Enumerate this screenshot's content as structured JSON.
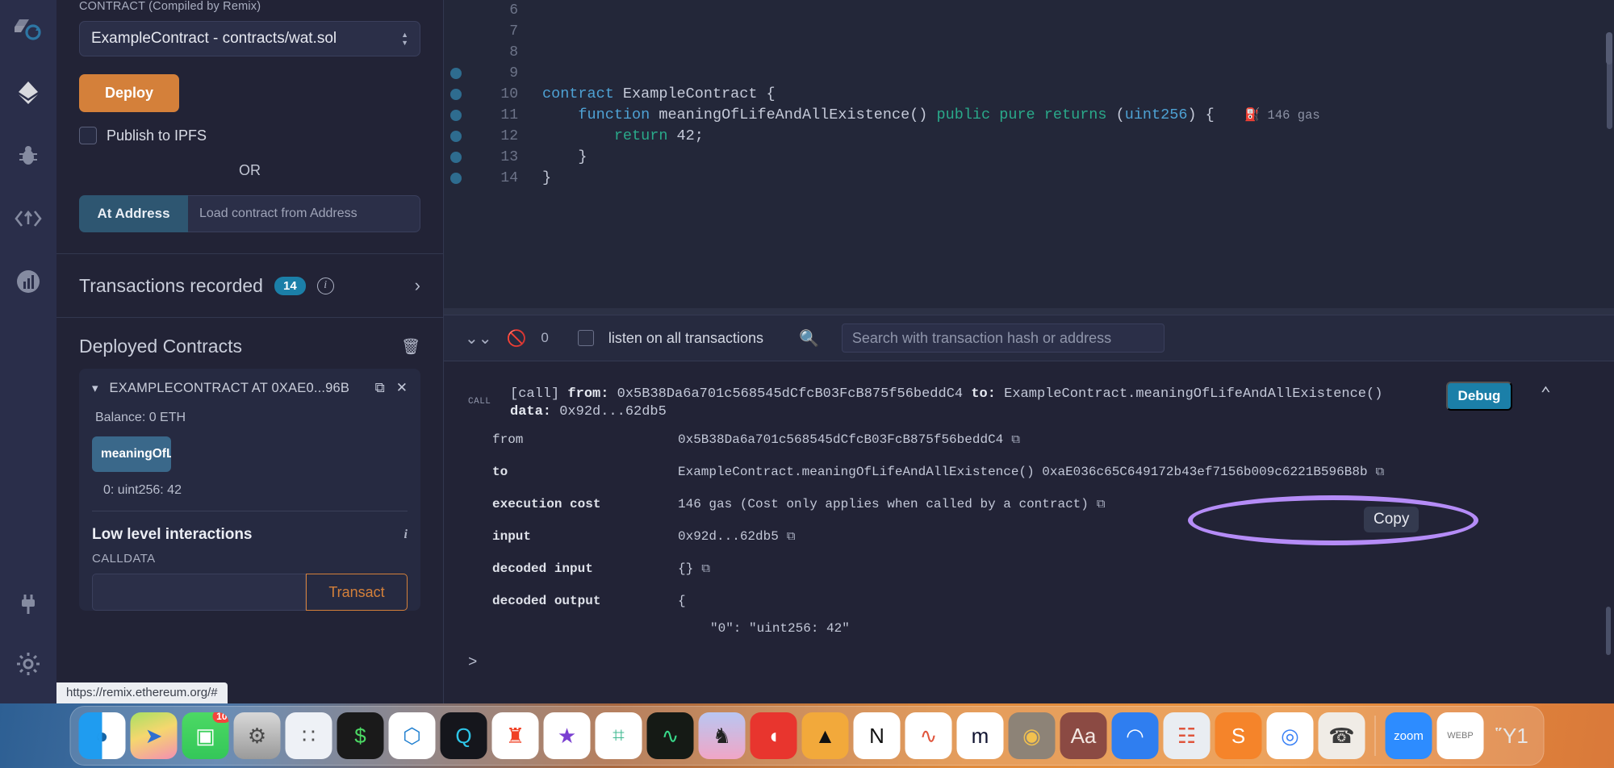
{
  "left_panel": {
    "contract_label": "CONTRACT (Compiled by Remix)",
    "contract_select": "ExampleContract - contracts/wat.sol",
    "deploy_button": "Deploy",
    "publish_ipfs": "Publish to IPFS",
    "or": "OR",
    "at_address_button": "At Address",
    "at_address_placeholder": "Load contract from Address",
    "transactions_recorded": "Transactions recorded",
    "transactions_count": "14",
    "deployed_contracts": "Deployed Contracts",
    "contract_instance": "EXAMPLECONTRACT AT 0XAE0...96B",
    "balance": "Balance: 0 ETH",
    "function_button": "meaningOfLifeAndAllExistence",
    "function_result": "0: uint256: 42",
    "low_level_title": "Low level interactions",
    "calldata_label": "CALLDATA",
    "calldata_value": "",
    "transact_button": "Transact"
  },
  "status_url": "https://remix.ethereum.org/#",
  "editor": {
    "lines": [
      {
        "num": "6",
        "marker": false,
        "code": ""
      },
      {
        "num": "7",
        "marker": false,
        "code": ""
      },
      {
        "num": "8",
        "marker": false,
        "code": ""
      },
      {
        "num": "9",
        "marker": true,
        "code": ""
      },
      {
        "num": "10",
        "marker": true,
        "code": "contract ExampleContract {"
      },
      {
        "num": "11",
        "marker": true,
        "code": "    function meaningOfLifeAndAllExistence() public pure returns (uint256) {"
      },
      {
        "num": "12",
        "marker": true,
        "code": "        return 42;"
      },
      {
        "num": "13",
        "marker": true,
        "code": "    }"
      },
      {
        "num": "14",
        "marker": true,
        "code": "}"
      }
    ],
    "gas_annotation": "146 gas"
  },
  "terminal": {
    "toolbar": {
      "pending_count": "0",
      "listen_label": "listen on all transactions",
      "search_placeholder": "Search with transaction hash or address"
    },
    "call_tag": "CALL",
    "call_line1_prefix": "[call]",
    "call_line1_from_label": "from:",
    "call_line1_from": "0x5B38Da6a701c568545dCfcB03FcB875f56beddC4",
    "call_line1_to_label": "to:",
    "call_line1_to": "ExampleContract.meaningOfLifeAndAllExistence()",
    "call_line2_label": "data:",
    "call_line2_data": "0x92d...62db5",
    "debug_button": "Debug",
    "rows": [
      {
        "key": "from",
        "value": "0x5B38Da6a701c568545dCfcB03FcB875f56beddC4",
        "copy": true
      },
      {
        "key": "to",
        "value": "ExampleContract.meaningOfLifeAndAllExistence() 0xaE036c65C649172b43ef7156b009c6221B596B8b",
        "copy": true
      },
      {
        "key": "execution cost",
        "value": "146 gas (Cost only applies when called by a contract)",
        "copy": true
      },
      {
        "key": "input",
        "value": "0x92d...62db5",
        "copy": true
      },
      {
        "key": "decoded input",
        "value": "{}",
        "copy": true
      },
      {
        "key": "decoded output",
        "value": "{",
        "copy": false
      }
    ],
    "decoded_output_body": "\"0\": \"uint256: 42\"",
    "copy_tooltip": "Copy",
    "prompt": ">"
  },
  "annotation": {
    "ellipse_color": "#b58cf7"
  },
  "dock": {
    "items": [
      {
        "name": "finder",
        "glyph": "◑",
        "bg": "linear-gradient(90deg,#1f9cf0 50%,#ffffff 50%)",
        "color": "#1565a6",
        "running": true
      },
      {
        "name": "maps",
        "glyph": "➤",
        "bg": "linear-gradient(160deg,#a8e063,#f5d76e 45%,#f48fb1)",
        "color": "#2f6fd0",
        "running": false
      },
      {
        "name": "facetime",
        "glyph": "▣",
        "bg": "linear-gradient(180deg,#4cd964,#34c759)",
        "color": "#ffffff",
        "running": false,
        "badge": "10"
      },
      {
        "name": "system-settings",
        "glyph": "⚙",
        "bg": "linear-gradient(180deg,#d8d8d8,#9a9a9a)",
        "color": "#4a4a4a",
        "running": false
      },
      {
        "name": "launchpad",
        "glyph": "∷",
        "bg": "#eef1f6",
        "color": "#555",
        "running": false
      },
      {
        "name": "terminal",
        "glyph": "$",
        "bg": "#1a1a1a",
        "color": "#4cd964",
        "running": true
      },
      {
        "name": "vscode",
        "glyph": "⬡",
        "bg": "#ffffff",
        "color": "#1f7fd0",
        "running": true
      },
      {
        "name": "quicktime",
        "glyph": "Q",
        "bg": "#15161c",
        "color": "#2ec6e8",
        "running": false
      },
      {
        "name": "brave",
        "glyph": "♜",
        "bg": "#ffffff",
        "color": "#f04024",
        "running": true
      },
      {
        "name": "imovie",
        "glyph": "★",
        "bg": "#ffffff",
        "color": "#7a3fd1",
        "running": false
      },
      {
        "name": "slack",
        "glyph": "⌗",
        "bg": "#ffffff",
        "color": "#3eb991",
        "running": true
      },
      {
        "name": "activity-monitor",
        "glyph": "∿",
        "bg": "#151a15",
        "color": "#39d98a",
        "running": true
      },
      {
        "name": "photos-horse",
        "glyph": "♞",
        "bg": "linear-gradient(180deg,#b9c6f2,#f0a6c6)",
        "color": "#222",
        "running": false
      },
      {
        "name": "firefox-dev",
        "glyph": "◖",
        "bg": "#e8352e",
        "color": "#ffffff",
        "running": false
      },
      {
        "name": "hardhat",
        "glyph": "▲",
        "bg": "#f2a93b",
        "color": "#111",
        "running": false
      },
      {
        "name": "notion",
        "glyph": "N",
        "bg": "#ffffff",
        "color": "#111",
        "running": true
      },
      {
        "name": "excalidraw",
        "glyph": "∿",
        "bg": "#ffffff",
        "color": "#e0553c",
        "running": true
      },
      {
        "name": "metamask-m",
        "glyph": "m",
        "bg": "#ffffff",
        "color": "#101330",
        "running": false
      },
      {
        "name": "food-app",
        "glyph": "◉",
        "bg": "#8d8377",
        "color": "#f2c14e",
        "running": true
      },
      {
        "name": "dictionary",
        "glyph": "Aa",
        "bg": "#8b4a43",
        "color": "#f3e7e2",
        "running": true
      },
      {
        "name": "nordvpn",
        "glyph": "◠",
        "bg": "#2f7ef0",
        "color": "#ffffff",
        "running": true
      },
      {
        "name": "news",
        "glyph": "☷",
        "bg": "#e9edf2",
        "color": "#e0553c",
        "running": false
      },
      {
        "name": "sublime",
        "glyph": "S",
        "bg": "#f5842a",
        "color": "#ffffff",
        "running": false
      },
      {
        "name": "chrome",
        "glyph": "◎",
        "bg": "#ffffff",
        "color": "#3b82f6",
        "running": false
      },
      {
        "name": "telescope-app",
        "glyph": "☎",
        "bg": "#f0ece6",
        "color": "#3a3a3a",
        "running": false
      },
      {
        "name": "zoom",
        "glyph": "zoom",
        "bg": "#2d8cff",
        "color": "#ffffff",
        "running": false
      },
      {
        "name": "webp-file",
        "glyph": "▤",
        "bg": "#ffffff",
        "color": "#777",
        "running": false,
        "label": "WEBP"
      },
      {
        "name": "trash",
        "glyph": "Ὕ1",
        "bg": "transparent",
        "color": "#e6e6e6",
        "running": false
      }
    ]
  }
}
